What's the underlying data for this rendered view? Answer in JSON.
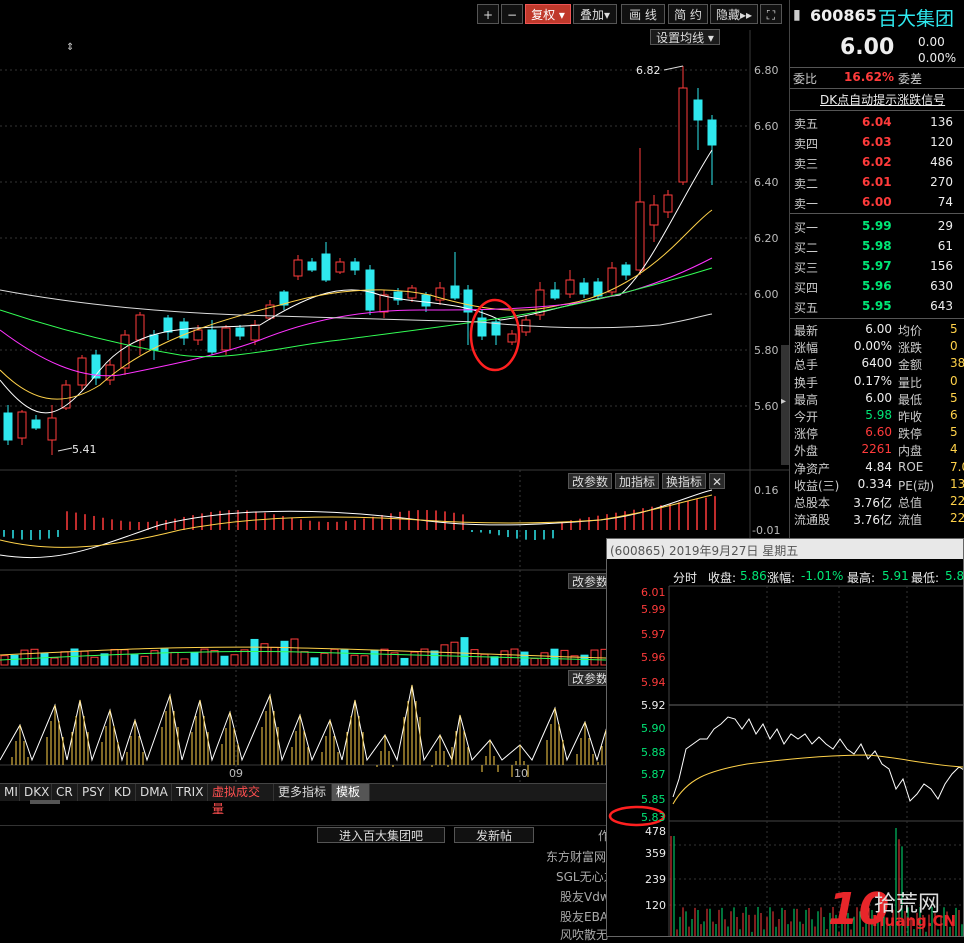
{
  "toolbar": {
    "plus": "+",
    "minus": "−",
    "fuquan": "复权 ▾",
    "diejia": "叠加▾",
    "huaxian": "画 线",
    "jianyue": "简 约",
    "yincang": "隐藏▸▸",
    "fullscreen_icon": "⛶"
  },
  "main_chart": {
    "set_ma_button": "设置均线 ▾",
    "high_label": "6.82",
    "low_label": "5.41",
    "price_ticks": [
      "6.80",
      "6.60",
      "6.40",
      "6.20",
      "6.00",
      "5.80",
      "5.60"
    ],
    "macd_ticks": [
      "0.16",
      "-0.01"
    ],
    "month_labels": [
      "09",
      "10"
    ],
    "indicator_buttons": [
      "改参数",
      "加指标",
      "换指标"
    ],
    "vol_param_button": "改参数",
    "third_param_button": "改参数"
  },
  "stock": {
    "code": "600865",
    "name": "百大集团",
    "price": "6.00",
    "change": "0.00",
    "change_pct": "0.00%",
    "weibi_label": "委比",
    "weibi_value": "16.62%",
    "weicha_label": "委差",
    "dk_signal": "DK点自动提示涨跌信号"
  },
  "order_book": {
    "asks": [
      {
        "label": "卖五",
        "price": "6.04",
        "vol": "136"
      },
      {
        "label": "卖四",
        "price": "6.03",
        "vol": "120"
      },
      {
        "label": "卖三",
        "price": "6.02",
        "vol": "486"
      },
      {
        "label": "卖二",
        "price": "6.01",
        "vol": "270"
      },
      {
        "label": "卖一",
        "price": "6.00",
        "vol": "74"
      }
    ],
    "bids": [
      {
        "label": "买一",
        "price": "5.99",
        "vol": "29"
      },
      {
        "label": "买二",
        "price": "5.98",
        "vol": "61"
      },
      {
        "label": "买三",
        "price": "5.97",
        "vol": "156"
      },
      {
        "label": "买四",
        "price": "5.96",
        "vol": "630"
      },
      {
        "label": "买五",
        "price": "5.95",
        "vol": "643"
      }
    ]
  },
  "quote_stats": [
    {
      "l1": "最新",
      "v1": "6.00",
      "c1": "white",
      "l2": "均价",
      "v2": "5"
    },
    {
      "l1": "涨幅",
      "v1": "0.00%",
      "c1": "white",
      "l2": "涨跌",
      "v2": "0"
    },
    {
      "l1": "总手",
      "v1": "6400",
      "c1": "white",
      "l2": "金额",
      "v2": "38"
    },
    {
      "l1": "换手",
      "v1": "0.17%",
      "c1": "white",
      "l2": "量比",
      "v2": "0"
    },
    {
      "l1": "最高",
      "v1": "6.00",
      "c1": "white",
      "l2": "最低",
      "v2": "5"
    },
    {
      "l1": "今开",
      "v1": "5.98",
      "c1": "green",
      "l2": "昨收",
      "v2": "6"
    },
    {
      "l1": "涨停",
      "v1": "6.60",
      "c1": "red",
      "l2": "跌停",
      "v2": "5"
    },
    {
      "l1": "外盘",
      "v1": "2261",
      "c1": "red",
      "l2": "内盘",
      "v2": "4"
    },
    {
      "l1": "净资产",
      "v1": "4.84",
      "c1": "white",
      "l2": "ROE",
      "v2": "7.0"
    },
    {
      "l1": "收益(三)",
      "v1": "0.334",
      "c1": "white",
      "l2": "PE(动)",
      "v2": "13"
    },
    {
      "l1": "总股本",
      "v1": "3.76亿",
      "c1": "white",
      "l2": "总值",
      "v2": "22."
    },
    {
      "l1": "流通股",
      "v1": "3.76亿",
      "c1": "white",
      "l2": "流值",
      "v2": "22."
    }
  ],
  "tabs": [
    "MI",
    "DKX",
    "CR",
    "PSY",
    "KD",
    "DMA",
    "TRIX",
    "虚拟成交量",
    "更多指标",
    "模板"
  ],
  "bottom": {
    "enter_forum": "进入百大集团吧",
    "post": "发新帖",
    "side_notes": [
      "东方财富网",
      "SGL无心之",
      "股友Vdw",
      "股友EBA",
      "风吹散无"
    ],
    "cut_char": "作"
  },
  "popup": {
    "header": "(600865) 2019年9月27日 星期五",
    "fenshi": "分时",
    "close_label": "收盘:",
    "close_value": "5.86",
    "chg_label": "涨幅:",
    "chg_value": "-1.01%",
    "high_label": "最高:",
    "high_value": "5.91",
    "low_label": "最低:",
    "low_value": "5.8",
    "price_ticks": [
      "6.01",
      "5.99",
      "5.97",
      "5.96",
      "5.94",
      "5.92",
      "5.90",
      "5.88",
      "5.87",
      "5.85",
      "5.83"
    ],
    "vol_ticks": [
      "478",
      "359",
      "239",
      "120"
    ]
  },
  "watermark": {
    "big": "10",
    "cn": "拾荒网",
    "url": "Huang.CN"
  },
  "colors": {
    "up": "#ff3b3b",
    "down": "#2ee8ee",
    "accent": "#c0392b"
  }
}
